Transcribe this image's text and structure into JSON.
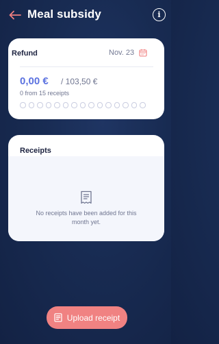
{
  "header": {
    "title": "Meal subsidy"
  },
  "refund": {
    "label": "Refund",
    "month": "Nov. 23",
    "amount": "0,00 €",
    "total": "/ 103,50 €",
    "receipt_count": "0 from 15 receipts",
    "receipts_progress": 0,
    "receipts_max": 15
  },
  "receipts": {
    "label": "Receipts",
    "empty_message": "No receipts have been added for this month yet."
  },
  "upload_button": {
    "label": "Upload receipt"
  },
  "colors": {
    "accent_blue": "#5b72e0",
    "upload_red": "#f08282",
    "background_navy": "#182b52"
  }
}
